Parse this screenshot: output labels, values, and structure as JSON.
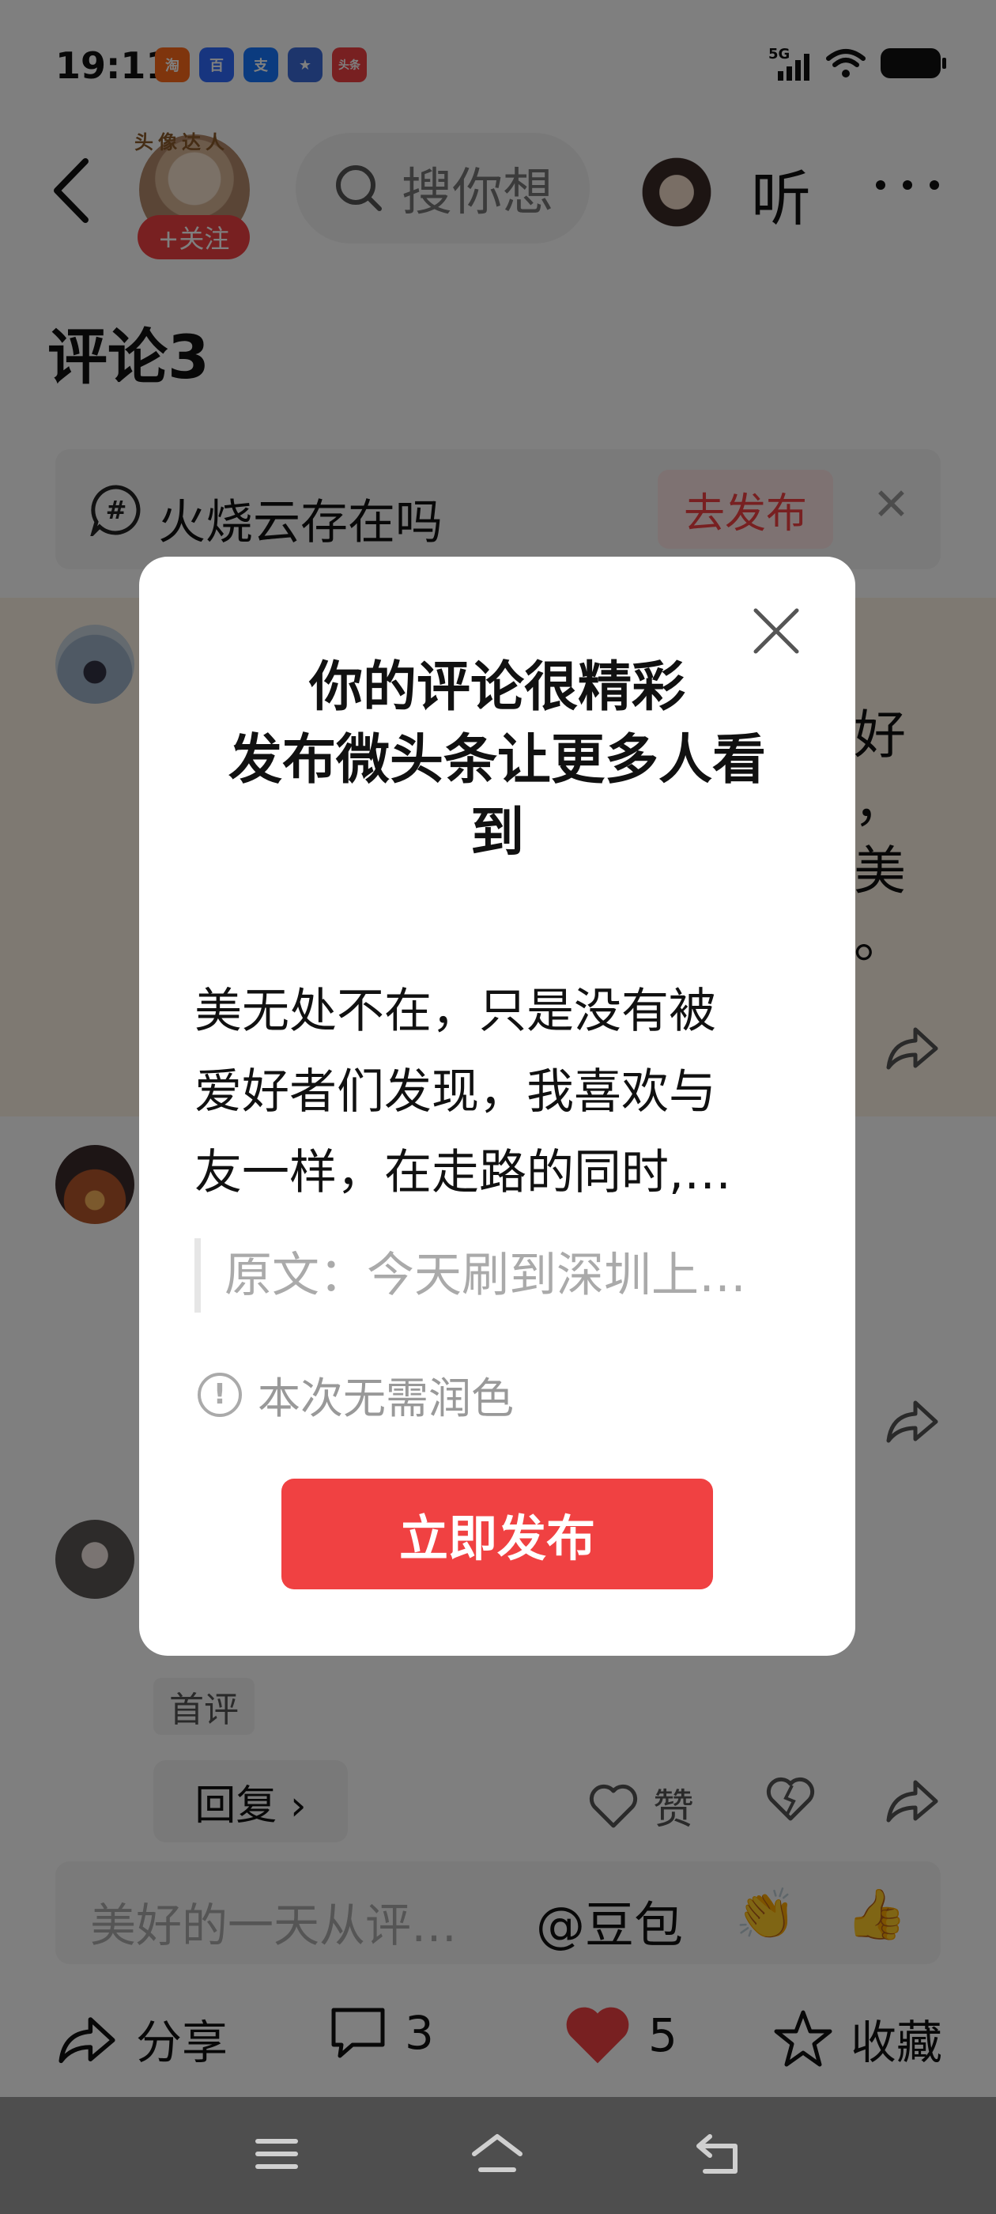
{
  "status_bar": {
    "time": "19:11",
    "network": "5G",
    "app_icons": [
      {
        "name": "taobao-icon",
        "glyph": "淘",
        "color": "#ff6a1a"
      },
      {
        "name": "baidu-icon",
        "glyph": "百",
        "color": "#2f6bff"
      },
      {
        "name": "alipay-icon",
        "glyph": "支",
        "color": "#1677ff"
      },
      {
        "name": "game-icon",
        "glyph": "★",
        "color": "#3a6bd8"
      },
      {
        "name": "toutiao-icon",
        "glyph": "头条",
        "color": "#f04142"
      }
    ]
  },
  "header": {
    "author_avatar_caption": "头像达人",
    "follow_label": "+关注",
    "search_placeholder": "搜你想",
    "listen_label": "听"
  },
  "comments": {
    "title": "评论3",
    "topic_card": {
      "topic": "火烧云存在吗",
      "publish_label": "去发布",
      "close_glyph": "✕"
    },
    "first_comment_peek": [
      "好",
      "，",
      "美",
      "。"
    ],
    "first_tag": "首评",
    "reply_label": "回复 ›",
    "like_label": "赞"
  },
  "quick_reply": {
    "placeholder": "美好的一天从评…",
    "mention": "@豆包",
    "emojis": [
      "👏",
      "👍"
    ]
  },
  "bottom_bar": {
    "share_label": "分享",
    "comment_count": "3",
    "like_count": "5",
    "favorite_label": "收藏"
  },
  "dialog": {
    "title_lines": [
      "你的评论很精彩",
      "发布微头条让更多人看",
      "到"
    ],
    "body_lines": [
      "美无处不在，只是没有被",
      "爱好者们发现，我喜欢与",
      "友一样，在走路的同时,…"
    ],
    "quote": "原文：今天刷到深圳上…",
    "note": "本次无需润色",
    "publish_button": "立即发布"
  },
  "colors": {
    "accent_red": "#f04142",
    "highlight_band": "#fdf3e4",
    "nav_bar": "#4e4e4e"
  }
}
